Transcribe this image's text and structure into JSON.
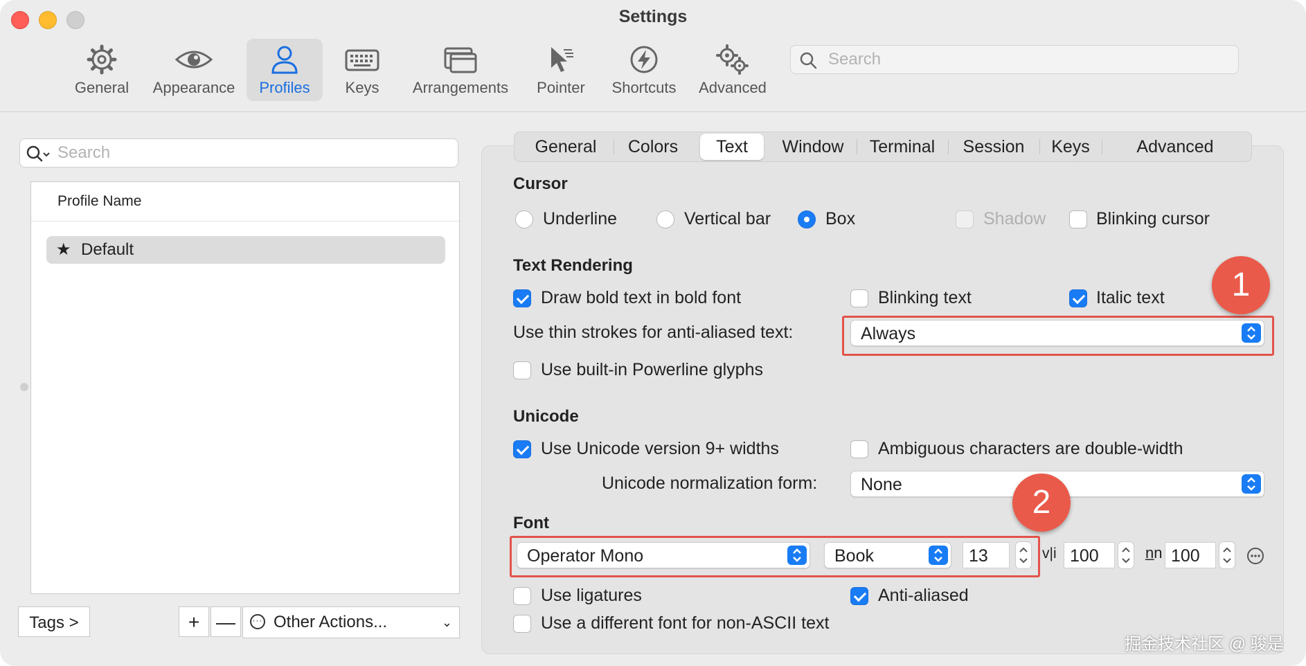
{
  "window": {
    "title": "Settings"
  },
  "toolbar": {
    "items": [
      {
        "label": "General",
        "icon": "gear-icon"
      },
      {
        "label": "Appearance",
        "icon": "eye-icon"
      },
      {
        "label": "Profiles",
        "icon": "person-icon"
      },
      {
        "label": "Keys",
        "icon": "keyboard-icon"
      },
      {
        "label": "Arrangements",
        "icon": "windows-icon"
      },
      {
        "label": "Pointer",
        "icon": "pointer-icon"
      },
      {
        "label": "Shortcuts",
        "icon": "bolt-icon"
      },
      {
        "label": "Advanced",
        "icon": "gears-icon"
      }
    ],
    "active": "Profiles",
    "search_placeholder": "Search"
  },
  "profiles": {
    "search_placeholder": "Search",
    "column_header": "Profile Name",
    "items": [
      {
        "name": "Default",
        "icon": "star-icon"
      }
    ],
    "tags_label": "Tags >",
    "add_label": "+",
    "remove_label": "—",
    "other_actions_label": "Other Actions..."
  },
  "tabs": {
    "items": [
      "General",
      "Colors",
      "Text",
      "Window",
      "Terminal",
      "Session",
      "Keys",
      "Advanced"
    ],
    "active": "Text"
  },
  "cursor": {
    "title": "Cursor",
    "underline": "Underline",
    "vertical_bar": "Vertical bar",
    "box": "Box",
    "selected": "Box",
    "shadow": "Shadow",
    "blinking": "Blinking cursor"
  },
  "rendering": {
    "title": "Text Rendering",
    "draw_bold": "Draw bold text in bold font",
    "blinking_text": "Blinking text",
    "italic_text": "Italic text",
    "thin_strokes_label": "Use thin strokes for anti-aliased text:",
    "thin_strokes_value": "Always",
    "powerline": "Use built-in Powerline glyphs"
  },
  "unicode": {
    "title": "Unicode",
    "version9": "Use Unicode version 9+ widths",
    "ambiguous": "Ambiguous characters are double-width",
    "normalization_label": "Unicode normalization form:",
    "normalization_value": "None"
  },
  "font": {
    "title": "Font",
    "family": "Operator Mono",
    "weight": "Book",
    "size": "13",
    "hspacing_glyph": "v|i",
    "hspacing": "100",
    "vspacing_glyph": "n̲n",
    "vspacing": "100",
    "ligatures": "Use ligatures",
    "anti_aliased": "Anti-aliased",
    "non_ascii": "Use a different font for non-ASCII text"
  },
  "annotations": {
    "badge1": "1",
    "badge2": "2",
    "highlight_color": "#e4534a"
  },
  "watermark": "掘金技术社区 @ 骏是",
  "colors": {
    "accent": "#1a7cf5",
    "badge": "#e95a4a"
  }
}
